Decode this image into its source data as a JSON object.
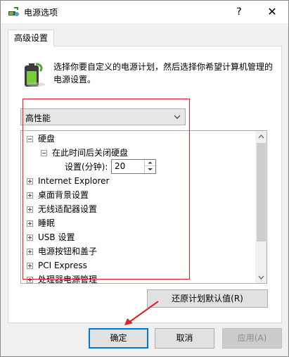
{
  "window": {
    "title": "电源选项",
    "help_label": "?",
    "close_label": "✕"
  },
  "tab": {
    "label": "高级设置"
  },
  "description": "选择你要自定义的电源计划，然后选择你希望计算机管理的电源设置。",
  "plan_select": {
    "value": "高性能"
  },
  "tree": {
    "items": [
      {
        "label": "硬盘",
        "expanded": true
      },
      {
        "label": "在此时间后关闭硬盘",
        "expanded": true
      },
      {
        "label": "设置(分钟):",
        "value": "20"
      },
      {
        "label": "Internet Explorer",
        "expanded": false
      },
      {
        "label": "桌面背景设置",
        "expanded": false
      },
      {
        "label": "无线适配器设置",
        "expanded": false
      },
      {
        "label": "睡眠",
        "expanded": false
      },
      {
        "label": "USB 设置",
        "expanded": false
      },
      {
        "label": "电源按钮和盖子",
        "expanded": false
      },
      {
        "label": "PCI Express",
        "expanded": false
      },
      {
        "label": "处理器电源管理",
        "expanded": false
      }
    ]
  },
  "buttons": {
    "restore": "还原计划默认值(R)",
    "ok": "确定",
    "cancel": "取消",
    "apply": "应用(A)"
  },
  "colors": {
    "highlight_box": "#e02020",
    "focus_border": "#0078d7"
  },
  "icons": {
    "title": "power-options-icon",
    "plan": "battery-power-icon"
  }
}
